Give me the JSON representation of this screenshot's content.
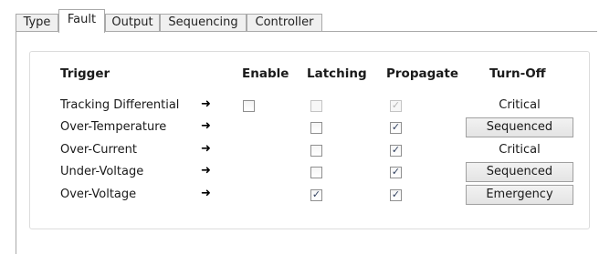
{
  "tabs": [
    {
      "label": "Type"
    },
    {
      "label": "Fault"
    },
    {
      "label": "Output"
    },
    {
      "label": "Sequencing"
    },
    {
      "label": "Controller"
    }
  ],
  "active_tab": "Fault",
  "headers": {
    "trigger": "Trigger",
    "enable": "Enable",
    "latching": "Latching",
    "propagate": "Propagate",
    "turn_off": "Turn-Off"
  },
  "arrow_icon": "➜",
  "check_glyph": "✓",
  "rows": [
    {
      "trigger": "Tracking Differential",
      "enable": "unchecked",
      "latching": "disabled-unchecked",
      "propagate": "disabled-checked",
      "turn_off": "Critical",
      "turn_off_button": false
    },
    {
      "trigger": "Over-Temperature",
      "enable": "none",
      "latching": "unchecked",
      "propagate": "checked",
      "turn_off": "Sequenced",
      "turn_off_button": true
    },
    {
      "trigger": "Over-Current",
      "enable": "none",
      "latching": "unchecked",
      "propagate": "checked",
      "turn_off": "Critical",
      "turn_off_button": false
    },
    {
      "trigger": "Under-Voltage",
      "enable": "none",
      "latching": "unchecked",
      "propagate": "checked",
      "turn_off": "Sequenced",
      "turn_off_button": true
    },
    {
      "trigger": "Over-Voltage",
      "enable": "none",
      "latching": "checked",
      "propagate": "checked",
      "turn_off": "Emergency",
      "turn_off_button": true
    }
  ]
}
